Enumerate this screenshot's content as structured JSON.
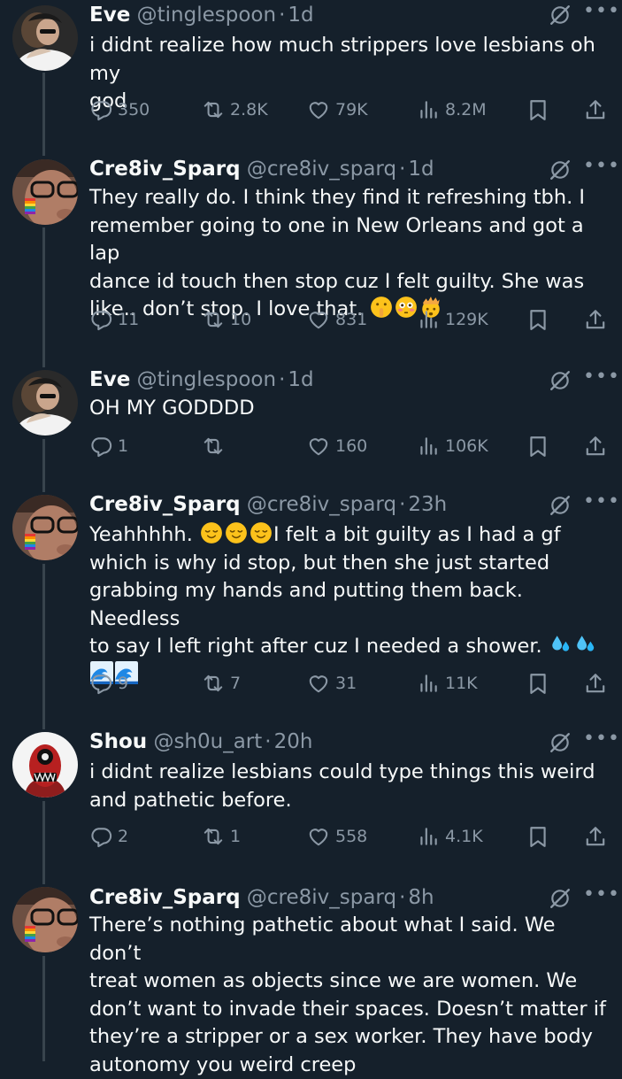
{
  "tweets": [
    {
      "name": "Eve",
      "handle": "@tinglespoon",
      "time": "1d",
      "avatar": "eve-avatar",
      "lines": [
        "i didnt realize how much strippers love lesbians oh my",
        "god"
      ],
      "replies": "350",
      "reposts": "2.8K",
      "likes": "79K",
      "views": "8.2M"
    },
    {
      "name": "Cre8iv_Sparq",
      "handle": "@cre8iv_sparq",
      "time": "1d",
      "avatar": "sparq-avatar",
      "lines": [
        "They really do. I think they find it refreshing tbh. I",
        "remember going to one in New Orleans and got a lap",
        "dance id touch then stop cuz I felt guilty. She was",
        "like.. don’t stop. I love that."
      ],
      "replies": "11",
      "reposts": "10",
      "likes": "831",
      "views": "129K"
    },
    {
      "name": "Eve",
      "handle": "@tinglespoon",
      "time": "1d",
      "avatar": "eve-avatar",
      "lines": [
        "OH MY GODDDD"
      ],
      "replies": "1",
      "reposts": "",
      "likes": "160",
      "views": "106K"
    },
    {
      "name": "Cre8iv_Sparq",
      "handle": "@cre8iv_sparq",
      "time": "23h",
      "avatar": "sparq-avatar",
      "lines": [
        "Yeahhhhh.",
        "I felt a bit guilty as I had a gf",
        "which is why id stop, but then she just started",
        "grabbing my hands and putting them back. Needless",
        "to say I left right after cuz I needed a shower."
      ],
      "replies": "9",
      "reposts": "7",
      "likes": "31",
      "views": "11K"
    },
    {
      "name": "Shou",
      "handle": "@sh0u_art",
      "time": "20h",
      "avatar": "shou-avatar",
      "lines": [
        "i didnt realize lesbians could type things this weird",
        "and pathetic before."
      ],
      "replies": "2",
      "reposts": "1",
      "likes": "558",
      "views": "4.1K"
    },
    {
      "name": "Cre8iv_Sparq",
      "handle": "@cre8iv_sparq",
      "time": "8h",
      "avatar": "sparq-avatar",
      "lines": [
        "There’s nothing pathetic about what I said. We don’t",
        "treat women as objects since we are women. We",
        "don’t want to invade their spaces. Doesn’t matter if",
        "they’re a stripper or a sex worker. They have body",
        "autonomy you weird creep"
      ]
    }
  ],
  "icons": {
    "reply": "reply-icon",
    "repost": "repost-icon",
    "like": "heart-icon",
    "views": "views-icon",
    "bookmark": "bookmark-icon",
    "share": "share-icon",
    "grok": "grok-icon",
    "more": "more-icon"
  },
  "colors": {
    "background": "#15202b",
    "text": "#f7f9f9",
    "muted": "#8b98a5",
    "line": "#38444d"
  }
}
